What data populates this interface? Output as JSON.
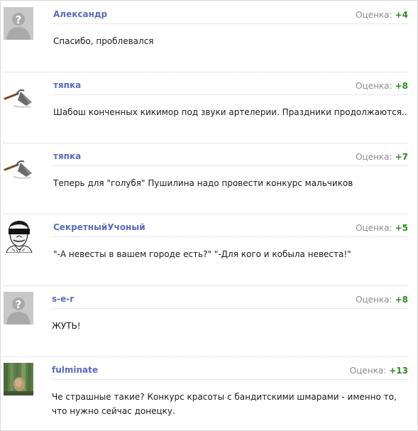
{
  "rating_label": "Оценка:",
  "comments": [
    {
      "author": "Александр",
      "rating": "+4",
      "text": "Спасибо, проблевался",
      "avatar": "placeholder-avatar"
    },
    {
      "author": "тяпка",
      "rating": "+8",
      "text": "Шабош конченных кикимор под звуки артелерии. Праздники продолжаются...",
      "avatar": "hoe-avatar"
    },
    {
      "author": "тяпка",
      "rating": "+7",
      "text": "Теперь для \"голубя\" Пушилина надо провести конкурс мальчиков",
      "avatar": "hoe-avatar"
    },
    {
      "author": "СекретныйУчоный",
      "rating": "+5",
      "text": "\"-А невесты в вашем городе есть?\" \"-Для кого и кобыла невеста!\"",
      "avatar": "masked-face-avatar"
    },
    {
      "author": "s-e-r",
      "rating": "+8",
      "text": "ЖУТЬ!",
      "avatar": "placeholder-avatar"
    },
    {
      "author": "fulminate",
      "rating": "+13",
      "text": "Че страшные такие? Конкурс красоты с бандитскими шмарами - именно то, что нужно сейчас донецку.",
      "avatar": "nature-photo-avatar"
    }
  ],
  "colors": {
    "author": "#5a6bbf",
    "rating_positive": "#2e8b1f",
    "rating_label": "#8c8c8c"
  }
}
